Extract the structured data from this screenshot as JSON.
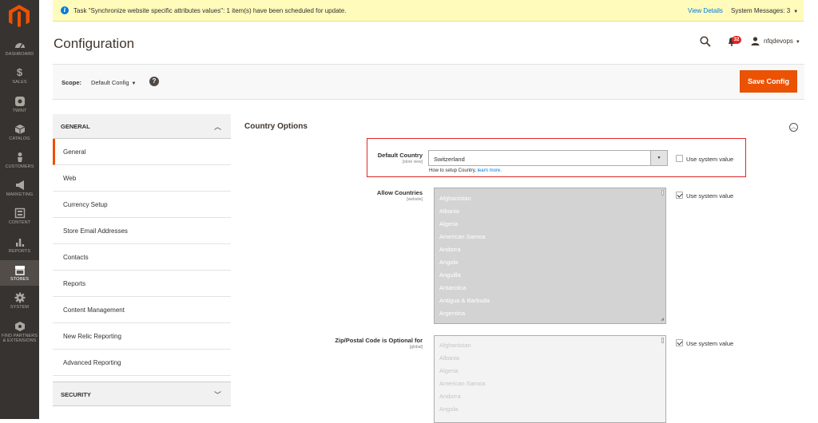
{
  "sidebar": {
    "items": [
      {
        "label": "DASHBOARD",
        "icon": "dashboard-icon"
      },
      {
        "label": "SALES",
        "icon": "dollar-icon"
      },
      {
        "label": "TWINT",
        "icon": "twint-icon"
      },
      {
        "label": "CATALOG",
        "icon": "cube-icon"
      },
      {
        "label": "CUSTOMERS",
        "icon": "person-icon"
      },
      {
        "label": "MARKETING",
        "icon": "megaphone-icon"
      },
      {
        "label": "CONTENT",
        "icon": "layout-icon"
      },
      {
        "label": "REPORTS",
        "icon": "bar-chart-icon"
      },
      {
        "label": "STORES",
        "icon": "store-icon"
      },
      {
        "label": "SYSTEM",
        "icon": "gear-icon"
      },
      {
        "label": "FIND PARTNERS & EXTENSIONS",
        "icon": "extensions-icon"
      }
    ]
  },
  "notice": {
    "message": "Task \"Synchronize website specific attributes values\": 1 item(s) have been scheduled for update.",
    "view_details": "View Details",
    "system_messages": "System Messages: 3"
  },
  "header": {
    "title": "Configuration",
    "notification_count": "32",
    "username": "nfqdevops"
  },
  "scope": {
    "label": "Scope:",
    "value": "Default Config",
    "help": "?",
    "save_label": "Save Config"
  },
  "config_nav": {
    "general_header": "GENERAL",
    "items": [
      "General",
      "Web",
      "Currency Setup",
      "Store Email Addresses",
      "Contacts",
      "Reports",
      "Content Management",
      "New Relic Reporting",
      "Advanced Reporting"
    ],
    "security_header": "SECURITY"
  },
  "section": {
    "title": "Country Options",
    "default_country": {
      "label": "Default Country",
      "scope": "[store view]",
      "value": "Switzerland",
      "note": "How to setup Country,",
      "note_link": "learn more."
    },
    "allow_countries": {
      "label": "Allow Countries",
      "scope": "[website]",
      "options": [
        "Afghanistan",
        "Albania",
        "Algeria",
        "American Samoa",
        "Andorra",
        "Angola",
        "Anguilla",
        "Antarctica",
        "Antigua & Barbuda",
        "Argentina"
      ]
    },
    "zip_optional": {
      "label": "Zip/Postal Code is Optional for",
      "scope": "[global]",
      "options": [
        "Afghanistan",
        "Albania",
        "Algeria",
        "American Samoa",
        "Andorra",
        "Angola"
      ]
    },
    "use_system_value": "Use system value"
  },
  "colors": {
    "sidebar_bg": "#373330",
    "accent": "#eb5202",
    "notice_bg": "#fffbbb",
    "highlight_border": "#e22626",
    "link": "#007bdb"
  }
}
